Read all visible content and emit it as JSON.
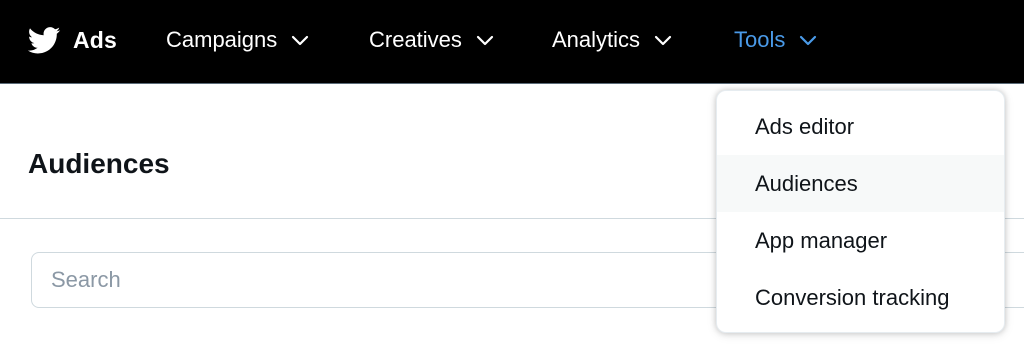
{
  "brand": {
    "label": "Ads",
    "icon": "twitter-bird-icon"
  },
  "nav": {
    "items": [
      {
        "label": "Campaigns",
        "icon": "chevron-down-icon"
      },
      {
        "label": "Creatives",
        "icon": "chevron-down-icon"
      },
      {
        "label": "Analytics",
        "icon": "chevron-down-icon"
      },
      {
        "label": "Tools",
        "icon": "chevron-down-icon",
        "active": true
      }
    ]
  },
  "tools_menu": {
    "items": [
      {
        "label": "Ads editor"
      },
      {
        "label": "Audiences",
        "highlighted": true
      },
      {
        "label": "App manager"
      },
      {
        "label": "Conversion tracking"
      }
    ]
  },
  "page": {
    "title": "Audiences",
    "search_placeholder": "Search"
  },
  "colors": {
    "nav_background": "#000000",
    "active_nav": "#4a9ae8",
    "text": "#0f1419",
    "border": "#cfd9de",
    "placeholder": "#8b98a5",
    "menu_hover": "#f7f9f9"
  }
}
